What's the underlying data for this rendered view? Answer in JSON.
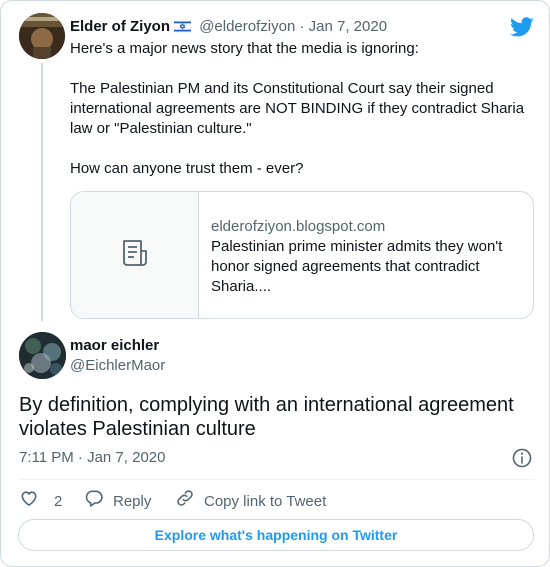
{
  "parent_tweet": {
    "author_name": "Elder of Ziyon",
    "handle": "@elderofziyon",
    "separator": "·",
    "date": "Jan 7, 2020",
    "text_1": "Here's a major news story that the media is ignoring:",
    "text_2": "The Palestinian PM and its Constitutional Court say their signed international agreements are NOT BINDING if they contradict Sharia law or \"Palestinian culture.\"",
    "text_3": "How can anyone trust them - ever?",
    "link_card": {
      "domain": "elderofziyon.blogspot.com",
      "title": "Palestinian prime minister admits they won't honor signed agreements that contradict Sharia...."
    }
  },
  "main_tweet": {
    "author_name": "maor eichler",
    "handle": "@EichlerMaor",
    "text": "By definition, complying with an international agreement violates Palestinian culture",
    "timestamp": "7:11 PM · Jan 7, 2020"
  },
  "actions": {
    "like_count": "2",
    "reply_label": "Reply",
    "copy_link_label": "Copy link to Tweet"
  },
  "explore_label": "Explore what's happening on Twitter",
  "colors": {
    "accent": "#1d9bf0",
    "muted_text": "#536471",
    "border": "#cfd9de"
  },
  "icons": [
    "twitter-logo-icon",
    "israel-flag-icon",
    "document-icon",
    "info-icon",
    "heart-icon",
    "reply-bubble-icon",
    "link-icon"
  ]
}
